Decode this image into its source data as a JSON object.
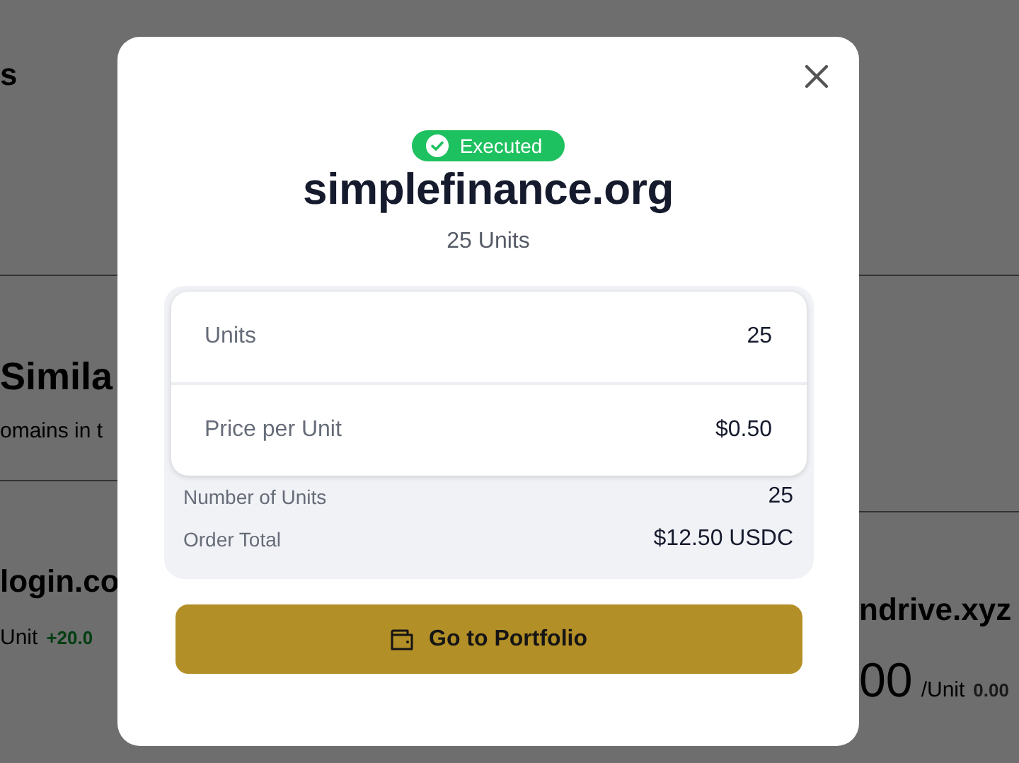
{
  "background": {
    "heading_fragment": "s",
    "section_title": "Simila",
    "section_subtitle": "omains in t",
    "cards": [
      {
        "name": "login.co",
        "unit": "Unit",
        "change": "+20.0",
        "color": "#003d12"
      },
      {
        "name": "ndrive.xyz",
        "price": "00",
        "unit": "/Unit",
        "change": "0.00",
        "color": "#1a1a1a"
      }
    ]
  },
  "modal": {
    "status": {
      "label": "Executed",
      "kind": "success"
    },
    "title": "simplefinance.org",
    "subtitle": "25 Units",
    "details": [
      {
        "label": "Units",
        "value": "25"
      },
      {
        "label": "Price per Unit",
        "value": "$0.50"
      }
    ],
    "summary": [
      {
        "label": "Number of Units",
        "value": "25"
      },
      {
        "label": "Order Total",
        "value": "$12.50 USDC"
      }
    ],
    "button": {
      "label": "Go to Portfolio"
    }
  }
}
